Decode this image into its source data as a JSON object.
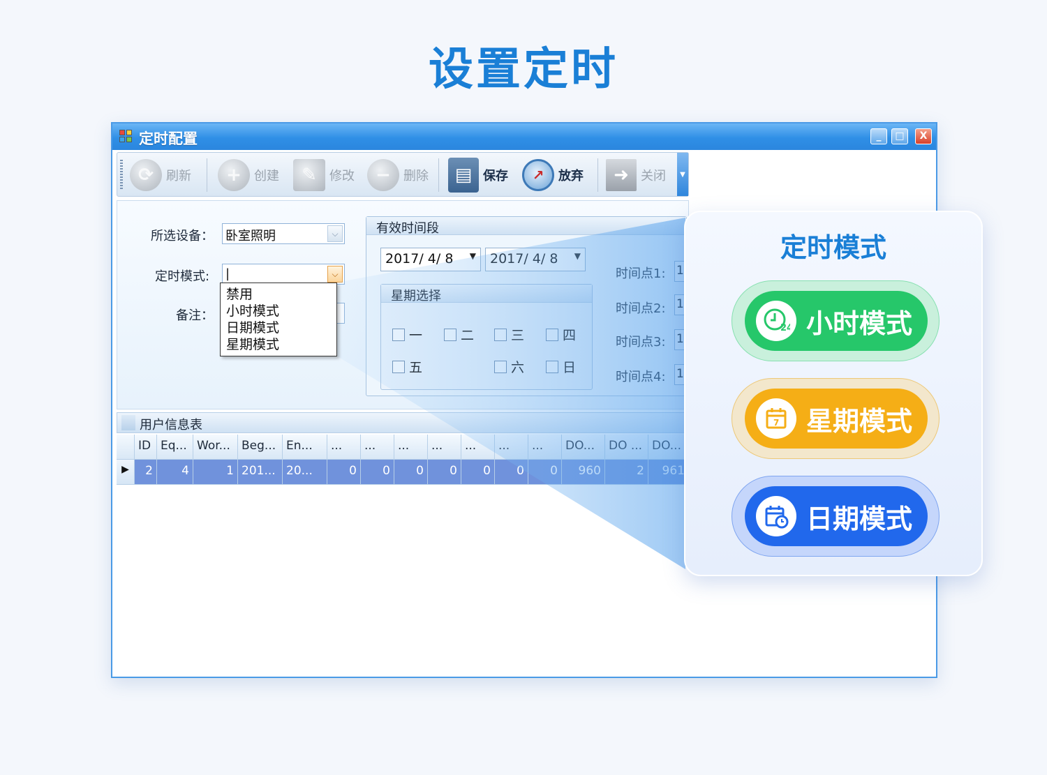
{
  "hero": {
    "title": "设置定时"
  },
  "window": {
    "title": "定时配置",
    "controls": {
      "minimize": "_",
      "maximize": "□",
      "close": "X"
    }
  },
  "toolbar": {
    "items": [
      {
        "label": "刷新",
        "icon": "refresh-icon",
        "enabled": false
      },
      {
        "label": "创建",
        "icon": "add-icon",
        "enabled": false
      },
      {
        "label": "修改",
        "icon": "edit-icon",
        "enabled": false
      },
      {
        "label": "删除",
        "icon": "remove-icon",
        "enabled": false
      },
      {
        "label": "保存",
        "icon": "save-disk-icon",
        "enabled": true
      },
      {
        "label": "放弃",
        "icon": "discard-clock-icon",
        "enabled": true
      },
      {
        "label": "关闭",
        "icon": "exit-door-icon",
        "enabled": false
      }
    ]
  },
  "form": {
    "device_label": "所选设备：",
    "device_value": "卧室照明",
    "mode_label": "定时模式:",
    "mode_value": "|",
    "note_label": "备注：",
    "mode_options": [
      "禁用",
      "小时模式",
      "日期模式",
      "星期模式"
    ]
  },
  "validity": {
    "title": "有效时间段",
    "start_date": "2017/  4/  8",
    "end_date": "2017/  4/  8",
    "week_title": "星期选择",
    "weekdays": [
      "一",
      "二",
      "三",
      "四",
      "五",
      "六",
      "日"
    ],
    "time_points": [
      {
        "label": "时间点1:",
        "value": "1"
      },
      {
        "label": "时间点2:",
        "value": "1"
      },
      {
        "label": "时间点3:",
        "value": "1"
      },
      {
        "label": "时间点4:",
        "value": "1"
      }
    ]
  },
  "grid": {
    "title": "用户信息表",
    "columns": [
      "ID",
      "Eq...",
      "Wor...",
      "Beg...",
      "En...",
      "...",
      "...",
      "...",
      "...",
      "...",
      "...",
      "...",
      "DO...",
      "DO ...",
      "DO..."
    ],
    "row": [
      "2",
      "4",
      "1",
      "201...",
      "20...",
      "0",
      "0",
      "0",
      "0",
      "0",
      "0",
      "0",
      "960",
      "2",
      "961"
    ],
    "row_indicator": "▶"
  },
  "callout": {
    "title": "定时模式",
    "modes": [
      {
        "label": "小时模式",
        "icon": "clock-24-icon",
        "color": "#26c76a",
        "badge": "24"
      },
      {
        "label": "星期模式",
        "icon": "calendar-week-icon",
        "color": "#f5ae16",
        "badge": "7"
      },
      {
        "label": "日期模式",
        "icon": "calendar-clock-icon",
        "color": "#2168ec"
      }
    ]
  }
}
